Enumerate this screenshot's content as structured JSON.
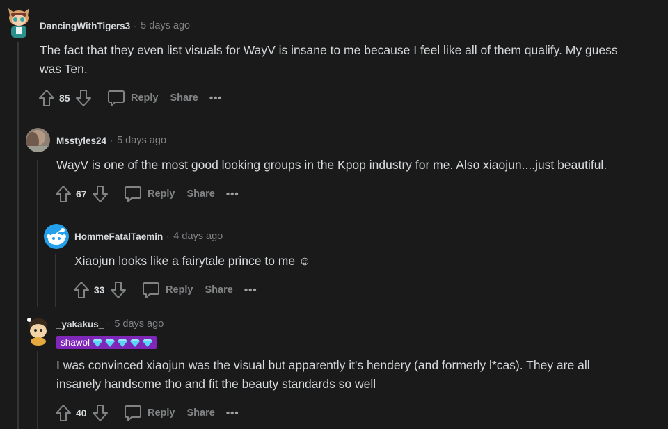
{
  "comments": [
    {
      "username": "DancingWithTigers3",
      "separator": "·",
      "time": "5 days ago",
      "text_lines": [
        "The fact that they even list visuals for WayV is insane to me because I feel like all of them qualify. My guess",
        "was Ten."
      ],
      "votes": "85",
      "reply_label": "Reply",
      "share_label": "Share",
      "more_label": "•••",
      "avatar_icon": "tiger-character-avatar-icon"
    },
    {
      "username": "Msstyles24",
      "separator": "·",
      "time": "5 days ago",
      "text_lines": [
        "WayV is one of the most good looking groups in the Kpop industry for me. Also xiaojun....just beautiful."
      ],
      "votes": "67",
      "reply_label": "Reply",
      "share_label": "Share",
      "more_label": "•••",
      "avatar_icon": "photo-avatar-icon"
    },
    {
      "username": "HommeFatalTaemin",
      "separator": "·",
      "time": "4 days ago",
      "text_lines": [
        "Xiaojun looks like a fairytale prince to me ☺"
      ],
      "votes": "33",
      "reply_label": "Reply",
      "share_label": "Share",
      "more_label": "•••",
      "avatar_icon": "default-snoo-avatar-icon"
    },
    {
      "username": "_yakakus_",
      "separator": "·",
      "time": "5 days ago",
      "flair": "shawol",
      "flair_icons": [
        "diamond-icon",
        "diamond-icon",
        "diamond-icon",
        "diamond-icon",
        "diamond-icon"
      ],
      "text_lines": [
        "I was convinced xiaojun was the visual but apparently it's hendery (and formerly l*cas). They are all",
        "insanely handsome tho and fit the beauty standards so well"
      ],
      "votes": "40",
      "reply_label": "Reply",
      "share_label": "Share",
      "more_label": "•••",
      "avatar_icon": "snoo-with-hat-avatar-icon"
    }
  ],
  "colors": {
    "background": "#1a1a1b",
    "text": "#d7dadc",
    "muted": "#818384",
    "thread_line": "#343536",
    "flair_bg": "#7e27b8",
    "gem": "#5cd6f5"
  }
}
